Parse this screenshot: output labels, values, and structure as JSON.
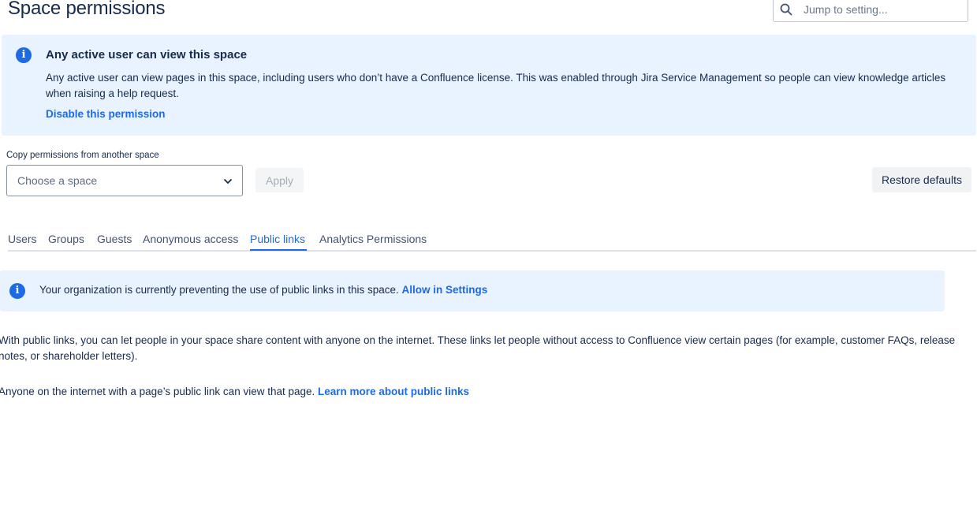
{
  "page": {
    "title": "Space permissions"
  },
  "search": {
    "placeholder": "Jump to setting...",
    "value": ""
  },
  "info_banner": {
    "title": "Any active user can view this space",
    "body": "Any active user can view pages in this space, including users who don’t have a Confluence license. This was enabled through Jira Service Management so people can view knowledge articles when raising a help request.",
    "link_label": "Disable this permission"
  },
  "copy_permissions": {
    "label": "Copy permissions from another space",
    "select_placeholder": "Choose a space",
    "apply_label": "Apply",
    "restore_label": "Restore defaults"
  },
  "tabs": [
    {
      "label": "Users",
      "active": false
    },
    {
      "label": "Groups",
      "active": false
    },
    {
      "label": "Guests",
      "active": false
    },
    {
      "label": "Anonymous access",
      "active": false
    },
    {
      "label": "Public links",
      "active": true
    },
    {
      "label": "Analytics Permissions",
      "active": false
    }
  ],
  "notice": {
    "text": "Your organization is currently preventing the use of public links in this space.",
    "link_label": "Allow in Settings"
  },
  "content": {
    "paragraph1": "With public links, you can let people in your space share content with anyone on the internet. These links let people without access to Confluence view certain pages (for example, customer FAQs, release notes, or shareholder letters).",
    "paragraph2_text": "Anyone on the internet with a page’s public link can view that page.",
    "paragraph2_link": "Learn more about public links"
  },
  "colors": {
    "accent": "#1d6ae5",
    "banner_bg": "#e9f2ff",
    "text": "#172b4d"
  },
  "icons": {
    "search": "search-icon",
    "info": "info-icon",
    "chevron": "chevron-down-icon"
  }
}
